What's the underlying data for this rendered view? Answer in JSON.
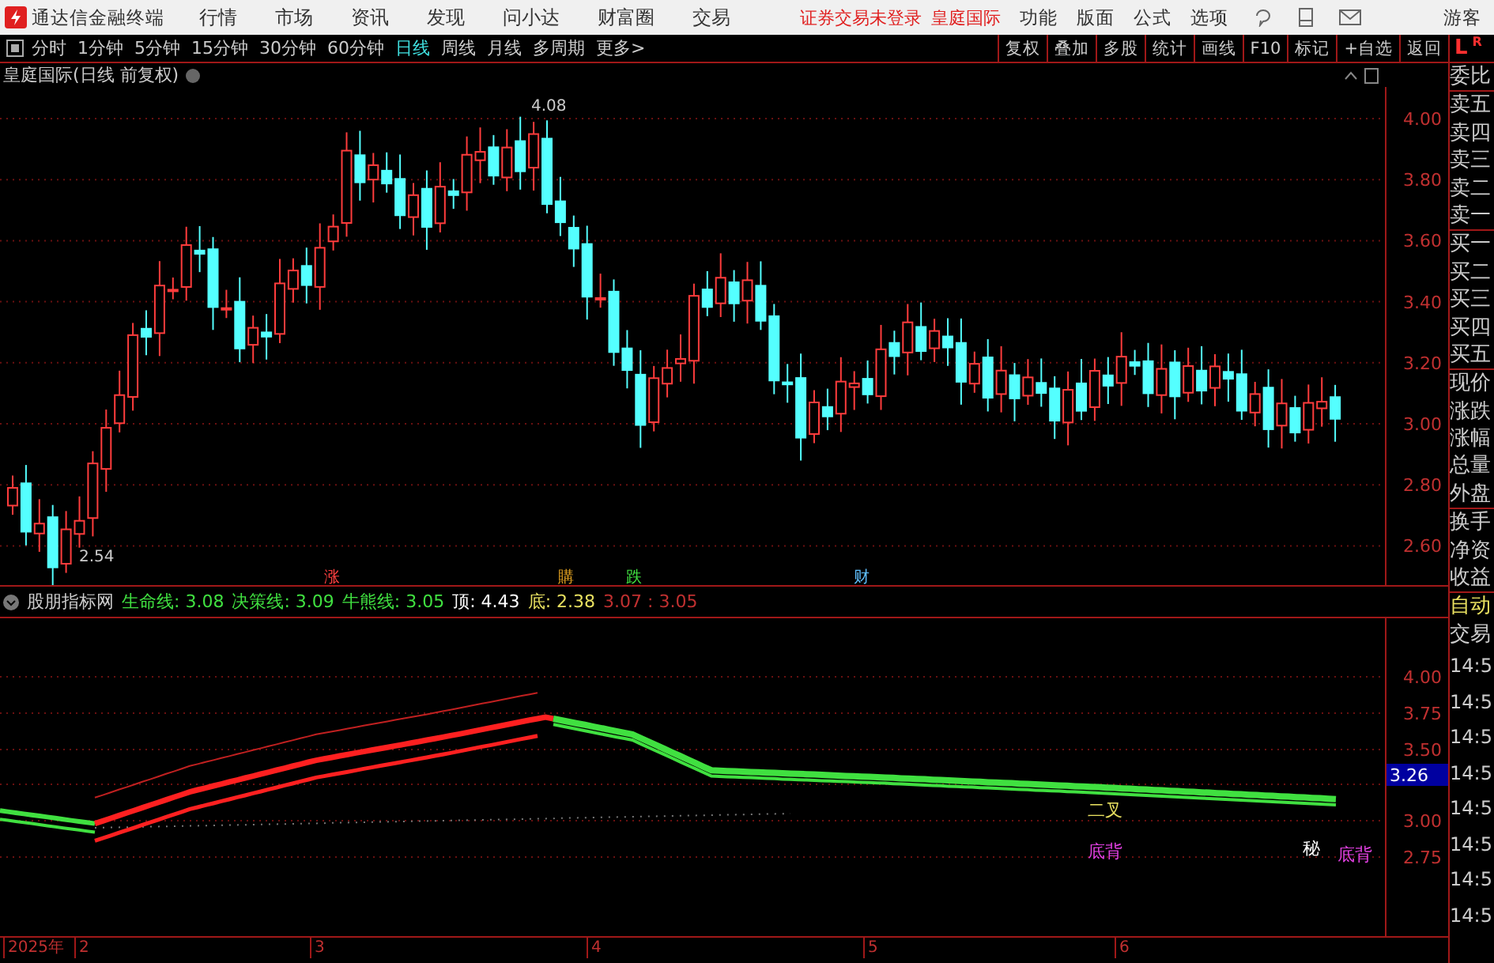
{
  "app": {
    "name": "通达信金融终端"
  },
  "menu": [
    "行情",
    "市场",
    "资讯",
    "发现",
    "问小达",
    "财富圈",
    "交易"
  ],
  "login_status": "证券交易未登录",
  "stock_link": "皇庭国际",
  "right_menu": [
    "功能",
    "版面",
    "公式",
    "选项"
  ],
  "user": "游客",
  "periods": [
    {
      "label": "分时",
      "selected": false
    },
    {
      "label": "1分钟",
      "selected": false
    },
    {
      "label": "5分钟",
      "selected": false
    },
    {
      "label": "15分钟",
      "selected": false
    },
    {
      "label": "30分钟",
      "selected": false
    },
    {
      "label": "60分钟",
      "selected": false
    },
    {
      "label": "日线",
      "selected": true
    },
    {
      "label": "周线",
      "selected": false
    },
    {
      "label": "月线",
      "selected": false
    },
    {
      "label": "多周期",
      "selected": false
    },
    {
      "label": "更多>",
      "selected": false
    }
  ],
  "tools": [
    "复权",
    "叠加",
    "多股",
    "统计",
    "画线",
    "F10",
    "标记",
    "+自选",
    "返回"
  ],
  "side_switch": [
    {
      "label": "L",
      "selected": true
    },
    {
      "label": "R",
      "selected": false
    }
  ],
  "chart": {
    "title": "皇庭国际(日线 前复权)",
    "high_label": "4.08",
    "low_label": "2.54",
    "price_ticks": [
      "4.00",
      "3.80",
      "3.60",
      "3.40",
      "3.20",
      "3.00",
      "2.80",
      "2.60"
    ],
    "events": [
      {
        "label": "涨",
        "color": "#ff4040"
      },
      {
        "label": "購",
        "color": "#e0a020"
      },
      {
        "label": "跌",
        "color": "#40e040"
      },
      {
        "label": "财",
        "color": "#60c0ff"
      }
    ]
  },
  "indicator": {
    "name": "股朋指标网",
    "values": [
      {
        "text": "生命线: 3.08",
        "color": "#40e040"
      },
      {
        "text": "决策线: 3.09",
        "color": "#40e040"
      },
      {
        "text": "牛熊线: 3.05",
        "color": "#40e040"
      },
      {
        "text": "顶: 4.43",
        "color": "#ffffff"
      },
      {
        "text": "底: 2.38",
        "color": "#e8e060"
      },
      {
        "text": "3.07 : 3.05",
        "color": "#c03030"
      }
    ],
    "ticks": [
      "4.00",
      "3.75",
      "3.50",
      "3.00",
      "2.75"
    ],
    "current": "3.26",
    "signals": [
      {
        "label": "二叉",
        "color": "#e8e060"
      },
      {
        "label": "底背",
        "color": "#e040e0"
      },
      {
        "label": "秘",
        "color": "#ffffff"
      },
      {
        "label": "底背",
        "color": "#e040e0"
      }
    ]
  },
  "x_axis": [
    "2025年",
    "2",
    "3",
    "4",
    "5",
    "6"
  ],
  "quote_panel": {
    "labels": [
      "委比",
      "卖五",
      "卖四",
      "卖三",
      "卖二",
      "卖一",
      "买一",
      "买二",
      "买三",
      "买四",
      "买五",
      "现价",
      "涨跌",
      "涨幅",
      "总量",
      "外盘",
      "换手",
      "净资",
      "收益"
    ],
    "auto": "自动",
    "trade": "交易",
    "times": [
      "14:5",
      "14:5",
      "14:5",
      "14:5",
      "14:5",
      "14:5",
      "14:5",
      "14:5"
    ]
  }
}
